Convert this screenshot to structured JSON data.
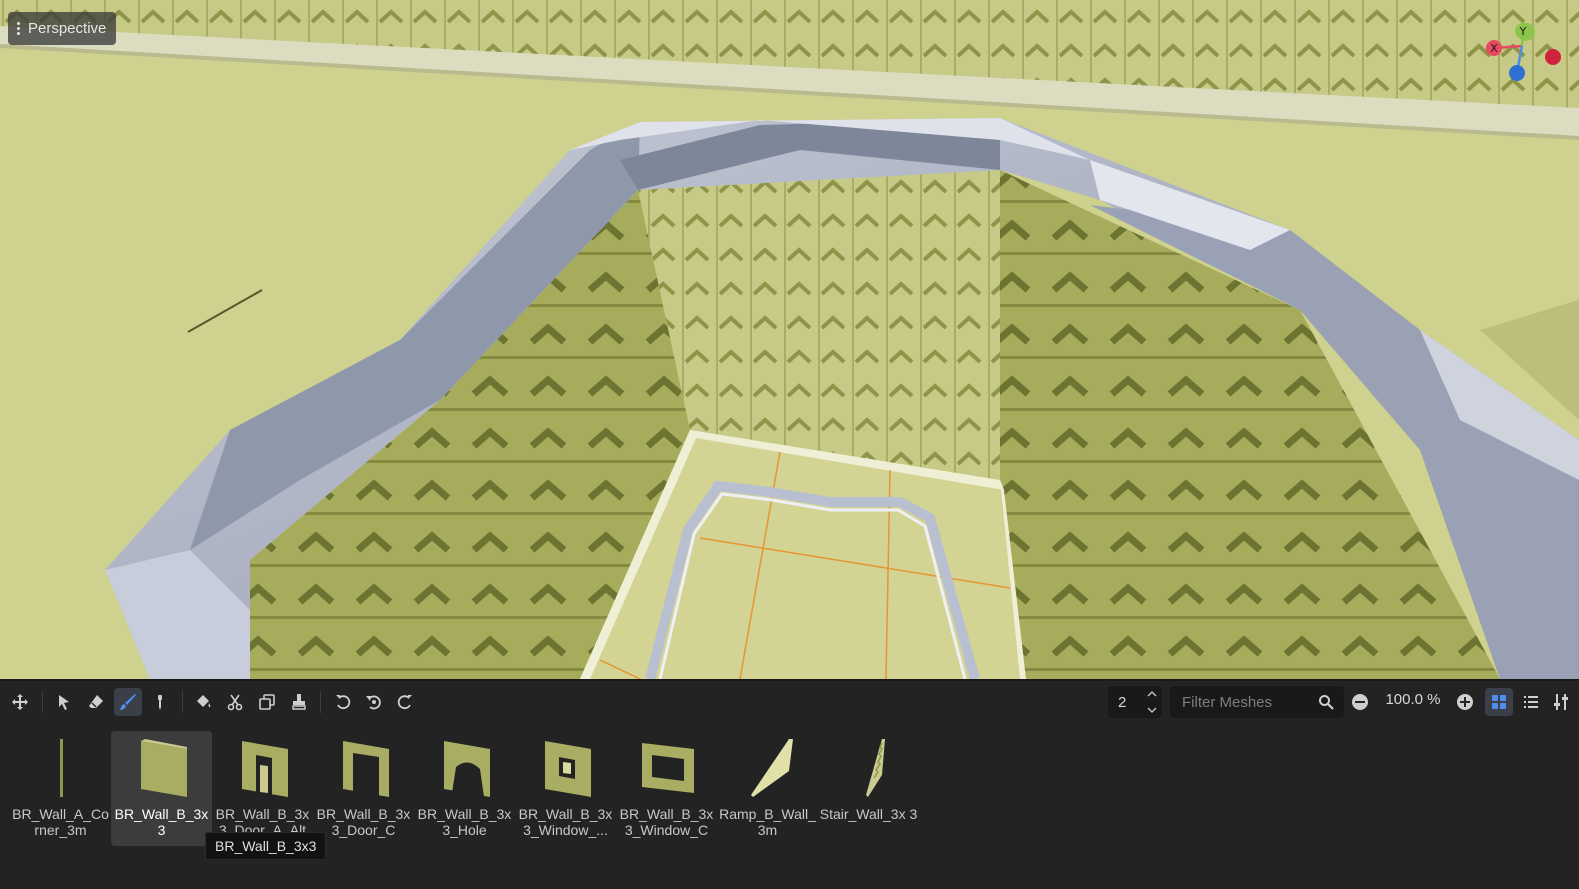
{
  "viewport": {
    "label": "Perspective",
    "axes": {
      "x": "X",
      "y": "Y"
    },
    "colors": {
      "floor": "#cfd18f",
      "wallpaper": "#c8cb8a",
      "stone": "#aeb4c4",
      "grid": "#e59632"
    }
  },
  "toolbar": {
    "tools": [
      {
        "name": "transform",
        "icon": "move-icon"
      },
      {
        "name": "select",
        "icon": "cursor-icon"
      },
      {
        "name": "erase",
        "icon": "eraser-icon"
      },
      {
        "name": "paint",
        "icon": "paintbrush-icon",
        "active": true
      },
      {
        "name": "pick",
        "icon": "eyedropper-icon"
      },
      {
        "name": "fill",
        "icon": "bucket-icon"
      },
      {
        "name": "cut",
        "icon": "scissors-icon"
      },
      {
        "name": "copy",
        "icon": "copy-icon"
      },
      {
        "name": "paste",
        "icon": "paste-icon"
      },
      {
        "name": "rotate-left",
        "icon": "rotate-left-icon"
      },
      {
        "name": "flip",
        "icon": "flip-icon"
      },
      {
        "name": "rotate-right",
        "icon": "rotate-right-icon"
      }
    ],
    "layer_value": "2",
    "filter_placeholder": "Filter Meshes",
    "zoom": "100.0 %",
    "accent": "#4d8fea"
  },
  "meshes": [
    {
      "name": "BR_Wall_A_Corner_3m",
      "label": "BR_Wall_A_Co rner_3m",
      "shape": "corner"
    },
    {
      "name": "BR_Wall_B_3x3",
      "label": "BR_Wall_B_3x 3",
      "shape": "wall",
      "selected": true
    },
    {
      "name": "BR_Wall_B_3x3_Door_A_Alt",
      "label": "BR_Wall_B_3x 3_Door_A_Alt",
      "shape": "door-alt"
    },
    {
      "name": "BR_Wall_B_3x3_Door_C",
      "label": "BR_Wall_B_3x 3_Door_C",
      "shape": "door"
    },
    {
      "name": "BR_Wall_B_3x3_Hole",
      "label": "BR_Wall_B_3x 3_Hole",
      "shape": "hole"
    },
    {
      "name": "BR_Wall_B_3x3_Window",
      "label": "BR_Wall_B_3x 3_Window_...",
      "shape": "window-small"
    },
    {
      "name": "BR_Wall_B_3x3_Window_C",
      "label": "BR_Wall_B_3x 3_Window_C",
      "shape": "window"
    },
    {
      "name": "Ramp_B_Wall_3m",
      "label": "Ramp_B_Wall_ 3m",
      "shape": "ramp"
    },
    {
      "name": "Stair_Wall_3x3",
      "label": "Stair_Wall_3x 3",
      "shape": "stair"
    }
  ],
  "tooltip": "BR_Wall_B_3x3"
}
